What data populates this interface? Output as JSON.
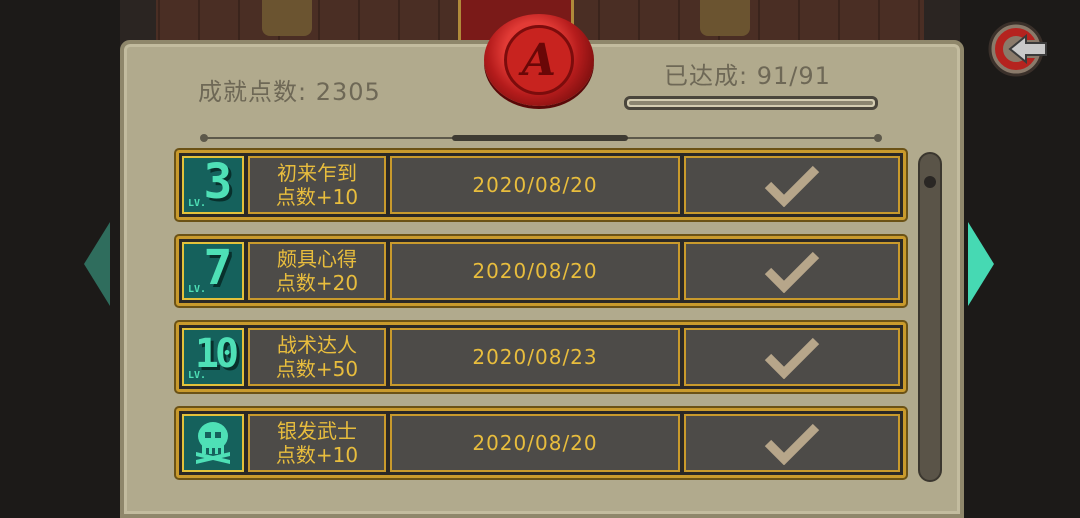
{
  "header": {
    "points_label": "成就点数: 2305",
    "achieved_label": "已达成: 91/91",
    "progress_fraction": 1.0,
    "seal_letter": "A"
  },
  "achievements": [
    {
      "level_number": "3",
      "level_prefix": "LV.",
      "icon": "level-badge",
      "name": "初来乍到",
      "points": "点数+10",
      "date": "2020/08/20",
      "completed": true
    },
    {
      "level_number": "7",
      "level_prefix": "LV.",
      "icon": "level-badge",
      "name": "颇具心得",
      "points": "点数+20",
      "date": "2020/08/20",
      "completed": true
    },
    {
      "level_number": "10",
      "level_prefix": "LV.",
      "icon": "level-badge",
      "name": "战术达人",
      "points": "点数+50",
      "date": "2020/08/23",
      "completed": true
    },
    {
      "level_number": "",
      "level_prefix": "",
      "icon": "skull-icon",
      "name": "银发武士",
      "points": "点数+10",
      "date": "2020/08/20",
      "completed": true
    }
  ],
  "colors": {
    "gold": "#e8bd3d",
    "badge_teal": "#4ee0b6",
    "parchment": "#b1aa8d",
    "check": "#b7a68a"
  },
  "icons": {
    "back": "back-arrow-icon",
    "prev": "chevron-left-icon",
    "next": "chevron-right-icon",
    "check": "checkmark-icon"
  }
}
